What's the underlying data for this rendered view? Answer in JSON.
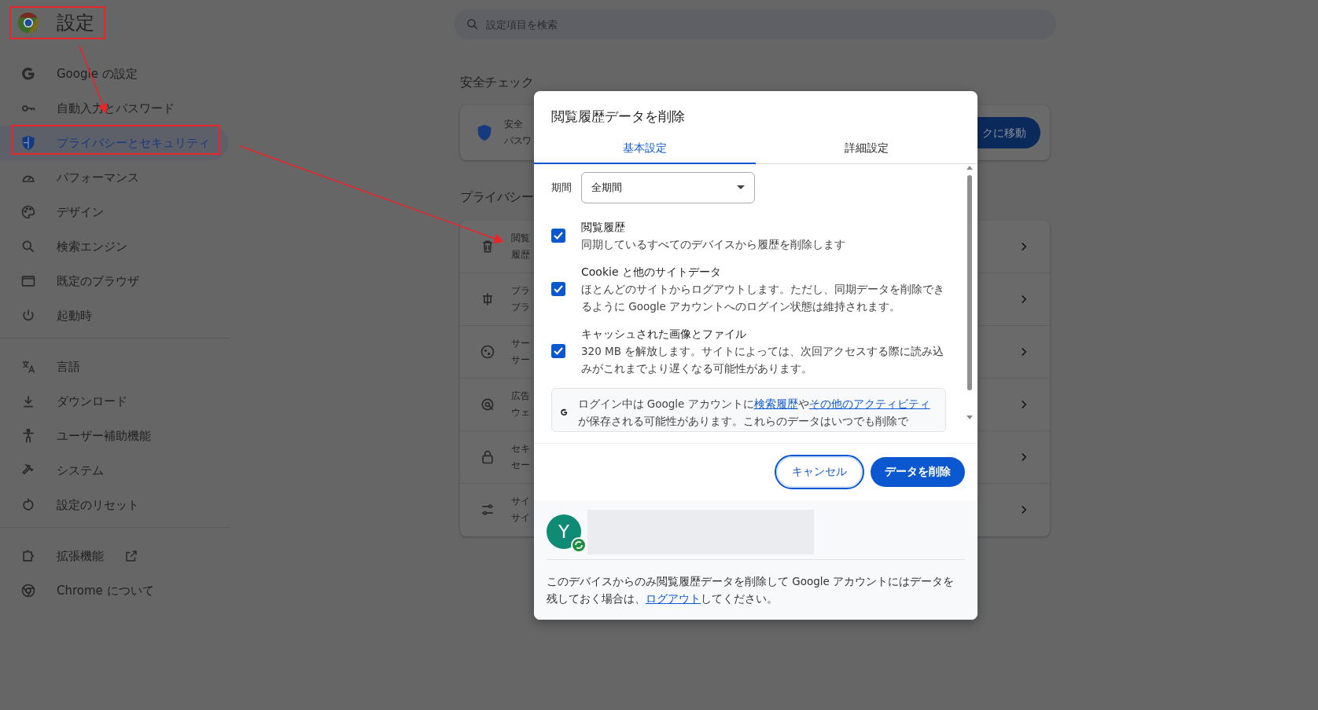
{
  "sidebar": {
    "title": "設定",
    "sections": [
      [
        {
          "label": "Google の設定",
          "selected": false
        },
        {
          "label": "自動入力とパスワード",
          "selected": false
        },
        {
          "label": "プライバシーとセキュリティ",
          "selected": true
        },
        {
          "label": "パフォーマンス",
          "selected": false
        },
        {
          "label": "デザイン",
          "selected": false
        },
        {
          "label": "検索エンジン",
          "selected": false
        },
        {
          "label": "既定のブラウザ",
          "selected": false
        },
        {
          "label": "起動時",
          "selected": false
        }
      ],
      [
        {
          "label": "言語",
          "selected": false
        },
        {
          "label": "ダウンロード",
          "selected": false
        },
        {
          "label": "ユーザー補助機能",
          "selected": false
        },
        {
          "label": "システム",
          "selected": false
        },
        {
          "label": "設定のリセット",
          "selected": false
        }
      ],
      [
        {
          "label": "拡張機能",
          "selected": false,
          "kind": "external"
        },
        {
          "label": "Chrome について",
          "selected": false,
          "kind": "plain"
        }
      ]
    ]
  },
  "search": {
    "placeholder": "設定項目を検索"
  },
  "safety": {
    "heading": "安全チェック",
    "line_1": "安全",
    "line_2": "パスワ",
    "button": "クに移動"
  },
  "privacy": {
    "heading": "プライバシー",
    "rows": [
      {
        "line_1": "閲覧",
        "line_2": "履歴"
      },
      {
        "line_1": "プラ",
        "line_2": "プラ"
      },
      {
        "line_1": "サー",
        "line_2": "サー"
      },
      {
        "line_1": "広告",
        "line_2": "ウェ"
      },
      {
        "line_1": "セキ",
        "line_2": "セー"
      },
      {
        "line_1": "サイ",
        "line_2": "サイ"
      }
    ]
  },
  "dialog": {
    "title": "閲覧履歴データを削除",
    "tabs": [
      {
        "label": "基本設定",
        "selected": true
      },
      {
        "label": "詳細設定",
        "selected": false
      }
    ],
    "period": {
      "label": "期間",
      "value": "全期間"
    },
    "options": [
      {
        "title": "閲覧履歴",
        "description": "同期しているすべてのデバイスから履歴を削除します",
        "checked": true
      },
      {
        "title": "Cookie と他のサイトデータ",
        "description": "ほとんどのサイトからログアウトします。ただし、同期データを削除できるように Google アカウントへのログイン状態は維持されます。",
        "checked": true
      },
      {
        "title": "キャッシュされた画像とファイル",
        "description": "320 MB を解放します。サイトによっては、次回アクセスする際に読み込みがこれまでより遅くなる可能性があります。",
        "checked": true
      }
    ],
    "notice": [
      {
        "text": "ログイン中は Google アカウントに",
        "link": false
      },
      {
        "text": "検索履歴",
        "link": true
      },
      {
        "text": "や",
        "link": false
      },
      {
        "text": "その他のアクティビティ",
        "link": true
      },
      {
        "text": "が保存される可能性があります。これらのデータはいつでも削除で",
        "link": false
      }
    ],
    "buttons": [
      {
        "label": "キャンセル",
        "kind": "outline"
      },
      {
        "label": "データを削除",
        "kind": "primary"
      }
    ],
    "account": {
      "initial": "Y"
    },
    "footer_note": [
      {
        "text": "このデバイスからのみ閲覧履歴データを削除して Google アカウントにはデータを残しておく場合は、",
        "link": false
      },
      {
        "text": "ログアウト",
        "link": true
      },
      {
        "text": "してください。",
        "link": false
      }
    ]
  }
}
